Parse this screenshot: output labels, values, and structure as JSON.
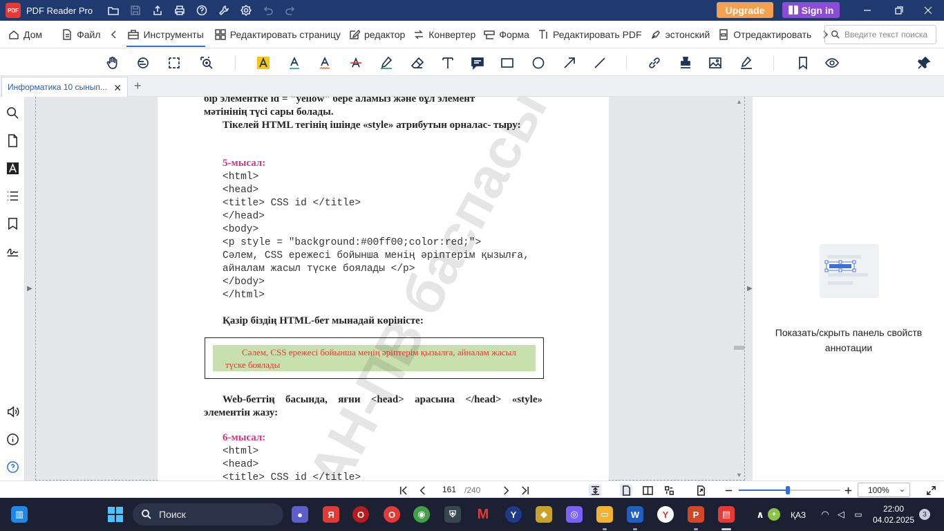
{
  "app": {
    "name": "PDF Reader Pro",
    "logo_text": "PDF",
    "upgrade_label": "Upgrade",
    "signin_label": "Sign in"
  },
  "colors": {
    "titlebar": "#1e3a6e",
    "upgrade": "#f5a04e",
    "signin": "#8c4cd6",
    "accent": "#2e6de6",
    "example_title": "#d63384",
    "demo_bg": "#c8dfae",
    "demo_text": "#e53935"
  },
  "menu": {
    "home": "Дом",
    "file": "Файл",
    "tools": "Инструменты",
    "edit_page": "Редактировать страницу",
    "editor": "редактор",
    "converter": "Конвертер",
    "form": "Форма",
    "edit_pdf": "Редактировать PDF",
    "estonian": "эстонский",
    "redact": "Отредактировать"
  },
  "search": {
    "placeholder": "Введите текст поиска"
  },
  "tab": {
    "title": "Информатика 10 сынып...",
    "close": "✕",
    "add": "+"
  },
  "document": {
    "line1": "бір элементке id = \"yellow\" бере аламыз және бұл элемент",
    "line2": "мәтінінің түсі сары болады.",
    "para2": "Тікелей HTML тегінің ішінде «style» атрибутын орналас- тыру:",
    "example5_title": "5-мысал:",
    "example5_code": [
      "<html>",
      "<head>",
      "<title> CSS id </title>",
      "</head>",
      "<body>",
      "<p style = \"background:#00ff00;color:red;\">",
      "Сәлем, CSS ережесі бойынша менің әріптерім қызылға,",
      "айналам жасыл түске боялады </p>",
      "</body>",
      "</html>"
    ],
    "now_text": "Қазір біздің HTML-бет мынадай көріністе:",
    "demo_text": "Сәлем, CSS ережесі бойынша менің әріптерім қызылға, айналам жасыл түске боялады",
    "para3": "Web-беттің басында, яғни <head> арасына </head> «style» элементін жазу:",
    "example6_title": "6-мысал:",
    "example6_code": [
      "<html>",
      "<head>",
      "<title> CSS id </title>"
    ],
    "watermark": "АН-ПВ баспасы"
  },
  "right_panel": {
    "text": "Показать/скрыть панель свойств аннотации"
  },
  "status": {
    "current_page": "161",
    "total_pages": "/240",
    "zoom": "100%",
    "zoom_fraction": 0.48
  },
  "taskbar": {
    "search_label": "Поиск",
    "lang": "ҚАЗ",
    "time": "22:00",
    "date": "04.02.2025",
    "notifications": "3"
  }
}
